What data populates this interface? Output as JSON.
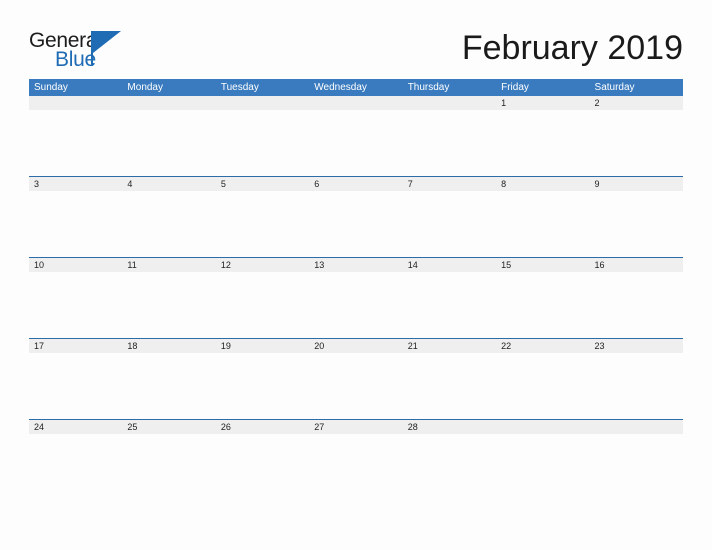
{
  "brand": {
    "name_part1": "General",
    "name_part2": "Blue",
    "flag_icon": "flag-icon",
    "accent_color": "#1f6cb4"
  },
  "header": {
    "title": "February 2019",
    "month": "February",
    "year": "2019"
  },
  "colors": {
    "header_blue": "#3a7bbf",
    "separator_blue": "#2d6ca8",
    "date_strip_gray": "#efefef",
    "page_background": "#fdfdfd",
    "title_text": "#1a1a1a"
  },
  "calendar": {
    "day_headers": [
      "Sunday",
      "Monday",
      "Tuesday",
      "Wednesday",
      "Thursday",
      "Friday",
      "Saturday"
    ],
    "weeks": [
      {
        "dates": [
          "",
          "",
          "",
          "",
          "",
          "1",
          "2"
        ]
      },
      {
        "dates": [
          "3",
          "4",
          "5",
          "6",
          "7",
          "8",
          "9"
        ]
      },
      {
        "dates": [
          "10",
          "11",
          "12",
          "13",
          "14",
          "15",
          "16"
        ]
      },
      {
        "dates": [
          "17",
          "18",
          "19",
          "20",
          "21",
          "22",
          "23"
        ]
      },
      {
        "dates": [
          "24",
          "25",
          "26",
          "27",
          "28",
          "",
          ""
        ]
      }
    ]
  }
}
